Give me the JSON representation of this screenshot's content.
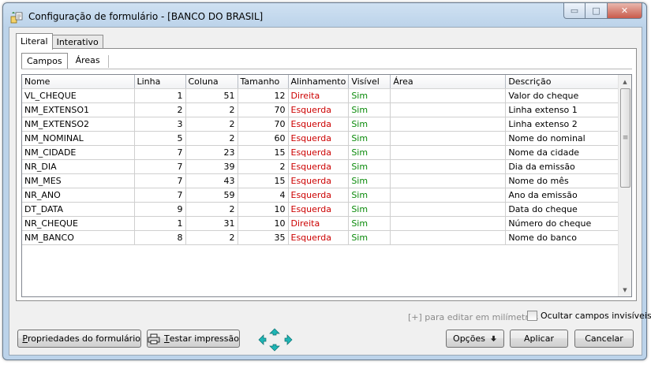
{
  "window": {
    "title": "Configuração de formulário - [BANCO DO BRASIL]",
    "min_glyph": "▭",
    "max_glyph": "□",
    "close_glyph": "✕"
  },
  "outer_tabs": [
    {
      "label": "Literal",
      "active": true
    },
    {
      "label": "Interativo",
      "active": false
    }
  ],
  "inner_tabs": [
    {
      "label": "Campos",
      "active": true
    },
    {
      "label": "Áreas",
      "active": false
    }
  ],
  "table": {
    "columns": [
      "Nome",
      "Linha",
      "Coluna",
      "Tamanho",
      "Alinhamento",
      "Visível",
      "Área",
      "Descrição"
    ],
    "rows": [
      [
        "VL_CHEQUE",
        "1",
        "51",
        "12",
        "Direita",
        "Sim",
        "",
        "Valor do cheque"
      ],
      [
        "NM_EXTENSO1",
        "2",
        "2",
        "70",
        "Esquerda",
        "Sim",
        "",
        "Linha extenso 1"
      ],
      [
        "NM_EXTENSO2",
        "3",
        "2",
        "70",
        "Esquerda",
        "Sim",
        "",
        "Linha extenso 2"
      ],
      [
        "NM_NOMINAL",
        "5",
        "2",
        "60",
        "Esquerda",
        "Sim",
        "",
        "Nome do nominal"
      ],
      [
        "NM_CIDADE",
        "7",
        "23",
        "15",
        "Esquerda",
        "Sim",
        "",
        "Nome da cidade"
      ],
      [
        "NR_DIA",
        "7",
        "39",
        "2",
        "Esquerda",
        "Sim",
        "",
        "Dia da emissão"
      ],
      [
        "NM_MES",
        "7",
        "43",
        "15",
        "Esquerda",
        "Sim",
        "",
        "Nome do mês"
      ],
      [
        "NR_ANO",
        "7",
        "59",
        "4",
        "Esquerda",
        "Sim",
        "",
        "Ano da emissão"
      ],
      [
        "DT_DATA",
        "9",
        "2",
        "10",
        "Esquerda",
        "Sim",
        "",
        "Data do cheque"
      ],
      [
        "NR_CHEQUE",
        "1",
        "31",
        "10",
        "Direita",
        "Sim",
        "",
        "Número do cheque"
      ],
      [
        "NM_BANCO",
        "8",
        "2",
        "35",
        "Esquerda",
        "Sim",
        "",
        "Nome do banco"
      ]
    ]
  },
  "colors": {
    "alignment_text": "#cc0000",
    "visible_text": "#0a8a0a"
  },
  "hint_text": "[+] para editar em milímetros",
  "hide_invisible_label": "Ocultar campos invisíveis",
  "buttons": {
    "properties_first": "P",
    "properties_rest": "ropriedades do formulário",
    "test_first": "T",
    "test_rest": "estar impressão",
    "options": "Opções",
    "apply": "Aplicar",
    "cancel": "Cancelar"
  }
}
